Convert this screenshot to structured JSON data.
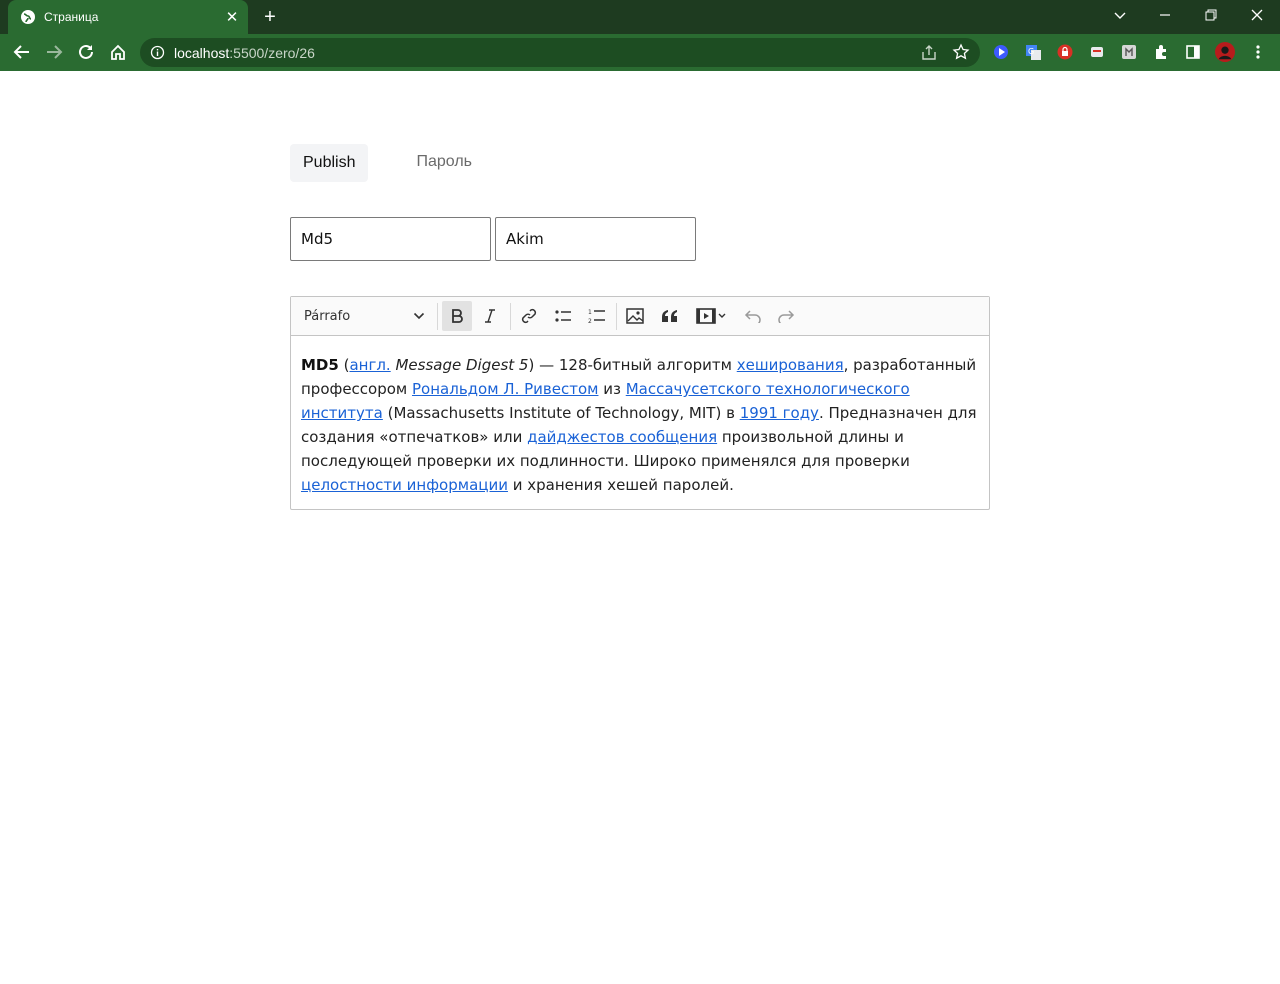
{
  "browser": {
    "tab_title": "Страница",
    "url_host": "localhost",
    "url_path": ":5500/zero/26"
  },
  "colors": {
    "chrome_dark": "#1e3b20",
    "chrome": "#2a6b31",
    "link": "#1a62d6"
  },
  "icons": [
    "globe-icon",
    "close-icon",
    "plus-icon",
    "back-icon",
    "forward-icon",
    "reload-icon",
    "home-icon",
    "info-icon",
    "share-icon",
    "star-icon",
    "puzzle-icon",
    "sidebar-icon",
    "kebab-icon"
  ],
  "page": {
    "tabs": [
      {
        "label": "Publish",
        "active": true
      },
      {
        "label": "Пароль",
        "active": false
      }
    ],
    "title_value": "Md5",
    "author_value": "Akim"
  },
  "editor": {
    "heading_select": "Párrafo",
    "content": {
      "bold": "MD5",
      "t1": " (",
      "link1": "англ.",
      "italic": " Message Digest 5",
      "t2": ") — 128-битный алгоритм ",
      "link2": "хеширования",
      "t3": ", разработанный профессором ",
      "link3": "Рональдом Л. Ривестом",
      "t4": " из ",
      "link4": "Массачусетского технологического института",
      "t5": " (Massachusetts Institute of Technology, MIT) в ",
      "link5": "1991 году",
      "t6": ". Предназначен для создания «отпечатков» или ",
      "link6": "дайджестов сообщения",
      "t7": " произвольной длины и последующей проверки их подлинности. Широко применялся для проверки ",
      "link7": "целостности информации",
      "t8": " и хранения хешей паролей."
    }
  }
}
